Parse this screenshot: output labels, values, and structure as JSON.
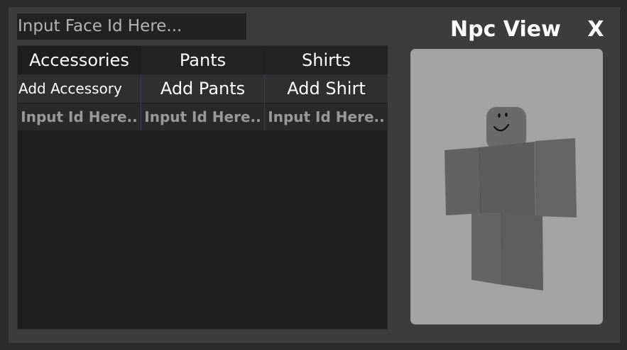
{
  "face_input": {
    "placeholder": "Input Face Id Here..."
  },
  "header": {
    "title": "Npc View",
    "close_label": "X"
  },
  "columns": [
    {
      "header": "Accessories",
      "button": "Add Accessory",
      "input_placeholder": "Input Id Here.."
    },
    {
      "header": "Pants",
      "button": "Add Pants",
      "input_placeholder": "Input Id Here.."
    },
    {
      "header": "Shirts",
      "button": "Add Shirt",
      "input_placeholder": "Input Id Here.."
    }
  ],
  "colors": {
    "background": "#2b2b2b",
    "window": "#3c3c3c",
    "panel": "#1e1e1e",
    "viewport": "#a3a3a3",
    "npc_body": "#646464"
  }
}
